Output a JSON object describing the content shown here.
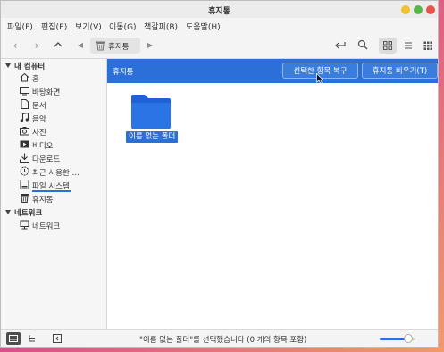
{
  "window": {
    "title": "휴지통"
  },
  "menubar": {
    "items": [
      "파일(F)",
      "편집(E)",
      "보기(V)",
      "이동(G)",
      "책갈피(B)",
      "도움말(H)"
    ]
  },
  "toolbar": {
    "location": "휴지통"
  },
  "sidebar": {
    "my_computer_label": "내 컴퓨터",
    "items": [
      {
        "label": "홈",
        "icon": "home-icon"
      },
      {
        "label": "바탕화면",
        "icon": "desktop-icon"
      },
      {
        "label": "문서",
        "icon": "document-icon"
      },
      {
        "label": "음악",
        "icon": "music-icon"
      },
      {
        "label": "사진",
        "icon": "camera-icon"
      },
      {
        "label": "비디오",
        "icon": "video-icon"
      },
      {
        "label": "다운로드",
        "icon": "download-icon"
      },
      {
        "label": "최근 사용한 …",
        "icon": "recent-icon"
      },
      {
        "label": "파일 시스템",
        "icon": "drive-icon"
      },
      {
        "label": "휴지통",
        "icon": "trash-icon"
      }
    ],
    "network_label": "네트워크",
    "network_items": [
      {
        "label": "네트워크",
        "icon": "network-icon"
      }
    ]
  },
  "banner": {
    "label": "휴지통",
    "restore_label": "선택한 항목 복구",
    "empty_label": "휴지통 비우기(T)"
  },
  "files": [
    {
      "name": "이름 없는 폴더",
      "icon": "folder-icon"
    }
  ],
  "statusbar": {
    "text": "\"이름 없는 폴더\"를 선택했습니다 (0 개의 항목 포함)",
    "zoom_fraction": 0.8
  },
  "colors": {
    "accent": "#2a70d8",
    "folder": "#1e63d6"
  }
}
